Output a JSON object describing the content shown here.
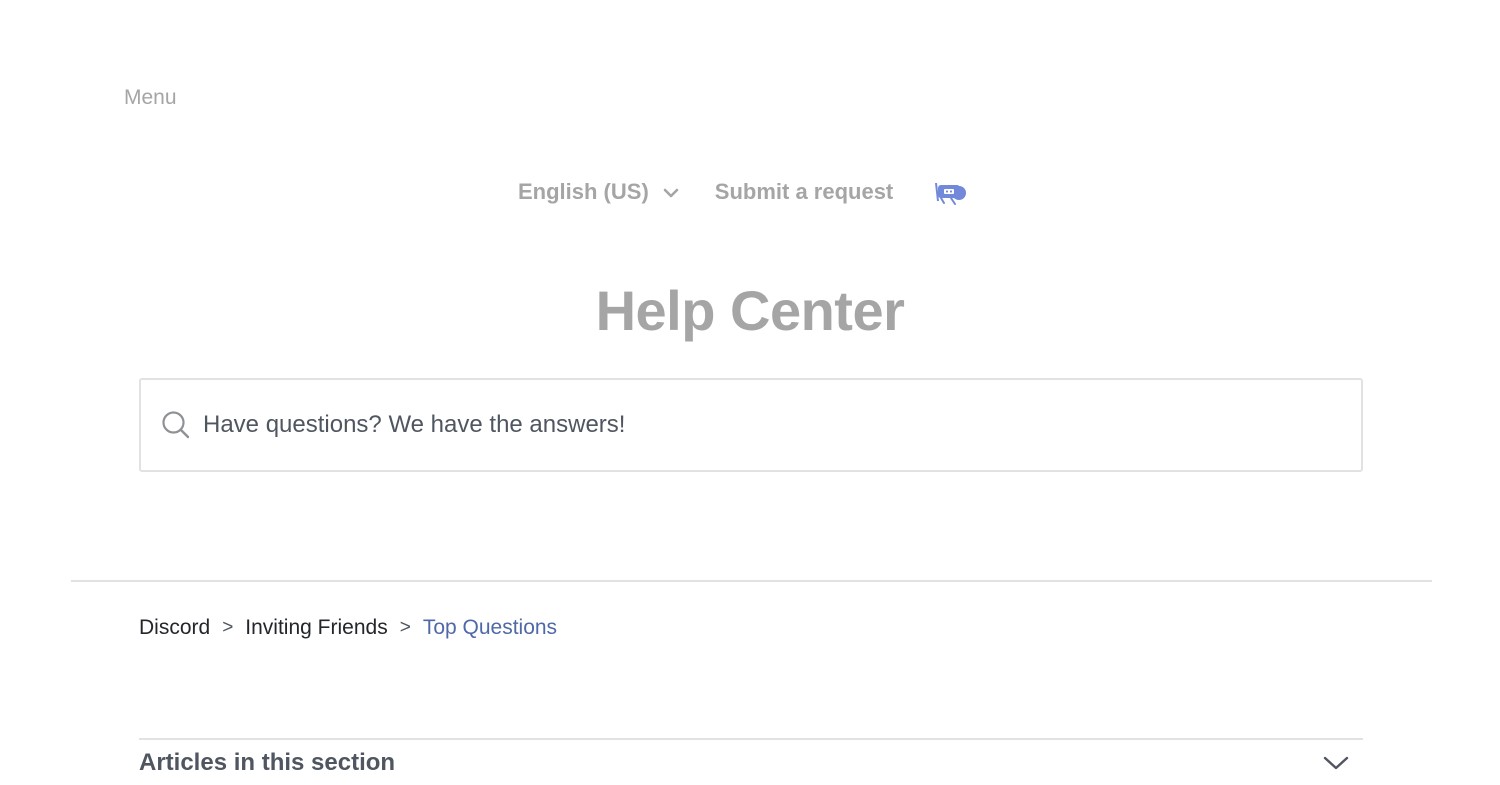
{
  "header": {
    "menu_label": "Menu",
    "language_label": "English (US)",
    "submit_request_label": "Submit a request",
    "logo_icon": "discord-mascot-icon"
  },
  "hero": {
    "title": "Help Center"
  },
  "search": {
    "placeholder": "Have questions? We have the answers!",
    "value": ""
  },
  "breadcrumb": {
    "items": [
      {
        "label": "Discord"
      },
      {
        "label": "Inviting Friends"
      },
      {
        "label": "Top Questions"
      }
    ],
    "separator": ">"
  },
  "articles_section": {
    "title": "Articles in this section"
  },
  "colors": {
    "muted_text": "#a5a5a5",
    "body_text": "#4f5660",
    "link_accent": "#4f69a8",
    "brand_blurple": "#7289da",
    "border": "#e2e2e2"
  }
}
